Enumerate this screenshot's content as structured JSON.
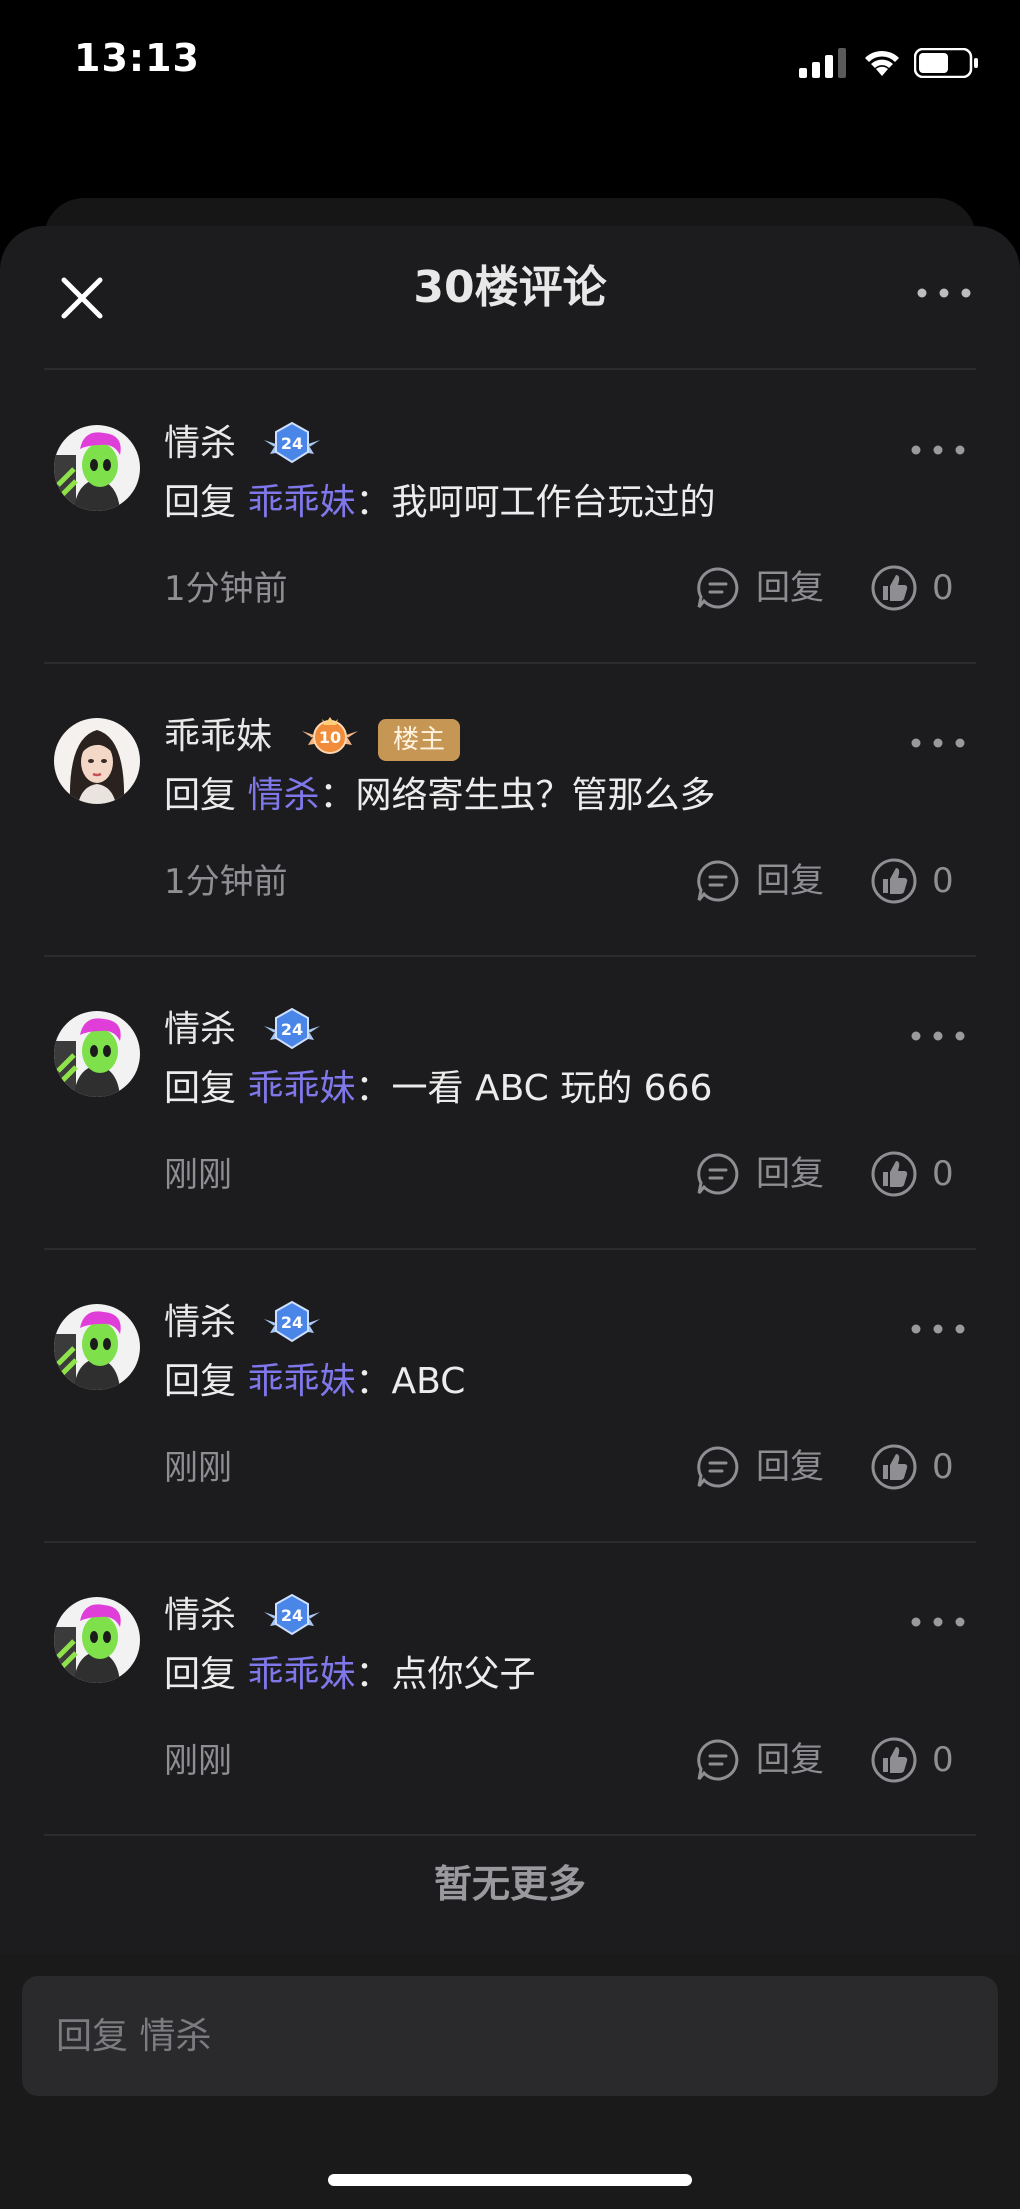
{
  "status_bar": {
    "time": "13:13",
    "battery_level": 0.6
  },
  "sheet": {
    "title": "30楼评论"
  },
  "comments": [
    {
      "username": "情杀",
      "avatar": "green-alien-avatar",
      "level": "24",
      "reply_word": "回复",
      "mention": "乖乖妹",
      "colon": "：",
      "text": "我呵呵工作台玩过的",
      "time": "1分钟前",
      "reply_label": "回复",
      "likes": "0"
    },
    {
      "username": "乖乖妹",
      "avatar": "woman-portrait-avatar",
      "level": "10",
      "host_tag": "楼主",
      "reply_word": "回复",
      "mention": "情杀",
      "colon": "：",
      "text": "网络寄生虫？管那么多",
      "time": "1分钟前",
      "reply_label": "回复",
      "likes": "0"
    },
    {
      "username": "情杀",
      "avatar": "green-alien-avatar",
      "level": "24",
      "reply_word": "回复",
      "mention": "乖乖妹",
      "colon": "：",
      "text": "一看 ABC 玩的 666",
      "time": "刚刚",
      "reply_label": "回复",
      "likes": "0"
    },
    {
      "username": "情杀",
      "avatar": "green-alien-avatar",
      "level": "24",
      "reply_word": "回复",
      "mention": "乖乖妹",
      "colon": "：",
      "text": "ABC",
      "time": "刚刚",
      "reply_label": "回复",
      "likes": "0"
    },
    {
      "username": "情杀",
      "avatar": "green-alien-avatar",
      "level": "24",
      "reply_word": "回复",
      "mention": "乖乖妹",
      "colon": "：",
      "text": "点你父子",
      "time": "刚刚",
      "reply_label": "回复",
      "likes": "0"
    }
  ],
  "footer": {
    "no_more": "暂无更多"
  },
  "input": {
    "placeholder": "回复 情杀"
  },
  "colors": {
    "mention": "#7f77ea",
    "level_blue": "#4a86e8",
    "level_orange": "#f08c3a",
    "host_tag": "#c69655",
    "sheet_bg": "#1c1c1e"
  }
}
